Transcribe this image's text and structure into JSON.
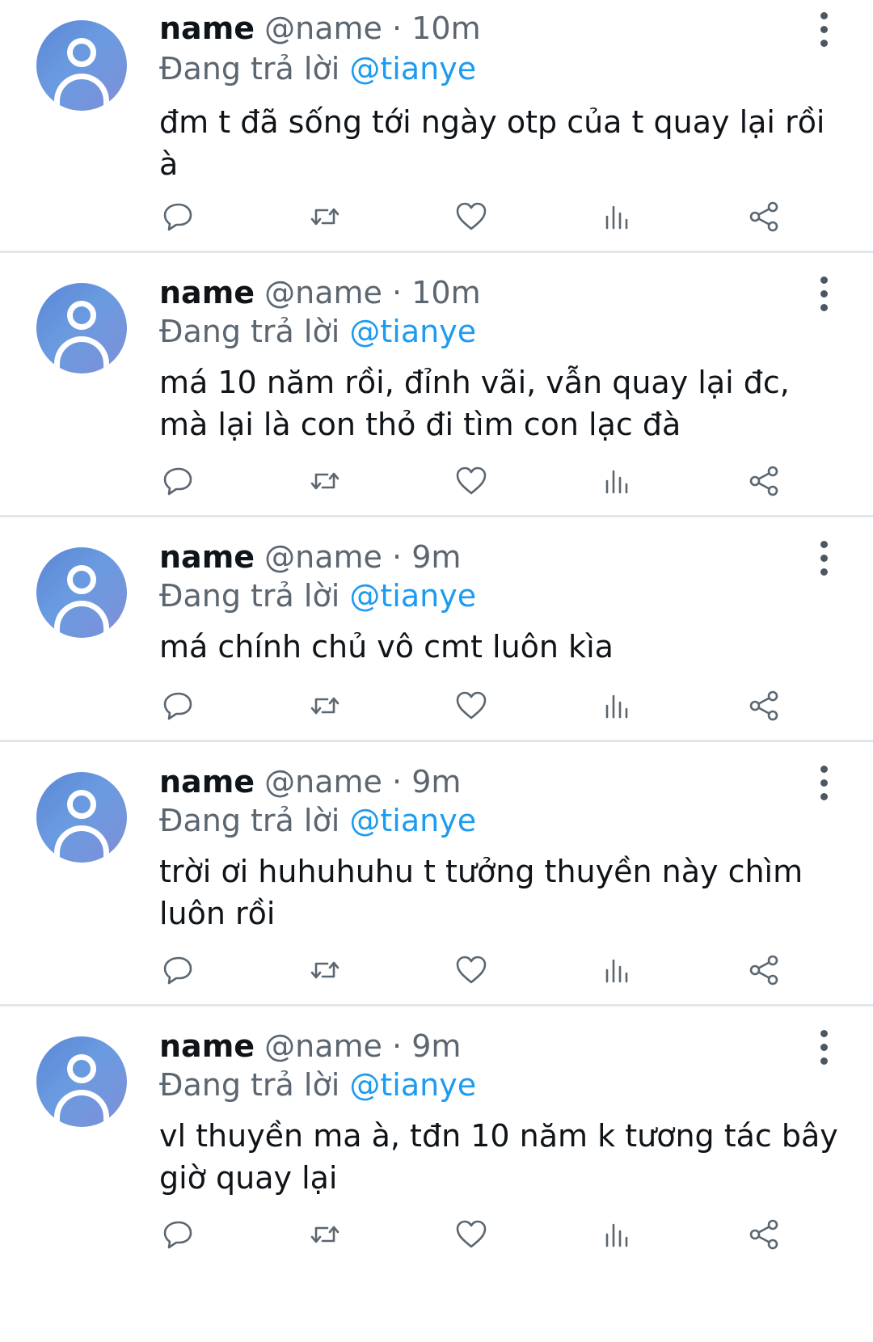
{
  "tweets": [
    {
      "display_name": "name",
      "handle": "@name",
      "time": "10m",
      "reply_prefix": "Đang trả lời",
      "reply_to": "@tianye",
      "text": "đm t đã sống tới ngày otp của t quay lại rồi à"
    },
    {
      "display_name": "name",
      "handle": "@name",
      "time": "10m",
      "reply_prefix": "Đang trả lời",
      "reply_to": "@tianye",
      "text": "má 10 năm rồi, đỉnh vãi, vẫn quay lại đc, mà lại là con thỏ đi tìm con lạc đà"
    },
    {
      "display_name": "name",
      "handle": "@name",
      "time": "9m",
      "reply_prefix": "Đang trả lời",
      "reply_to": "@tianye",
      "text": "má chính chủ vô cmt luôn kìa"
    },
    {
      "display_name": "name",
      "handle": "@name",
      "time": "9m",
      "reply_prefix": "Đang trả lời",
      "reply_to": "@tianye",
      "text": "trời ơi huhuhuhu t tưởng thuyền này chìm luôn rồi"
    },
    {
      "display_name": "name",
      "handle": "@name",
      "time": "9m",
      "reply_prefix": "Đang trả lời",
      "reply_to": "@tianye",
      "text": "vl thuyền ma à, tđn 10 năm k tương tác bây giờ quay lại"
    }
  ],
  "separator": "·",
  "icons": {
    "avatar": "default-profile-icon",
    "more": "more-vertical-icon",
    "reply": "reply-icon",
    "retweet": "retweet-icon",
    "like": "heart-icon",
    "views": "views-chart-icon",
    "share": "share-icon"
  },
  "colors": {
    "mention": "#1d9bf0",
    "secondary_text": "#5b6670",
    "primary_text": "#0f1419",
    "divider": "#e3e6e8"
  }
}
